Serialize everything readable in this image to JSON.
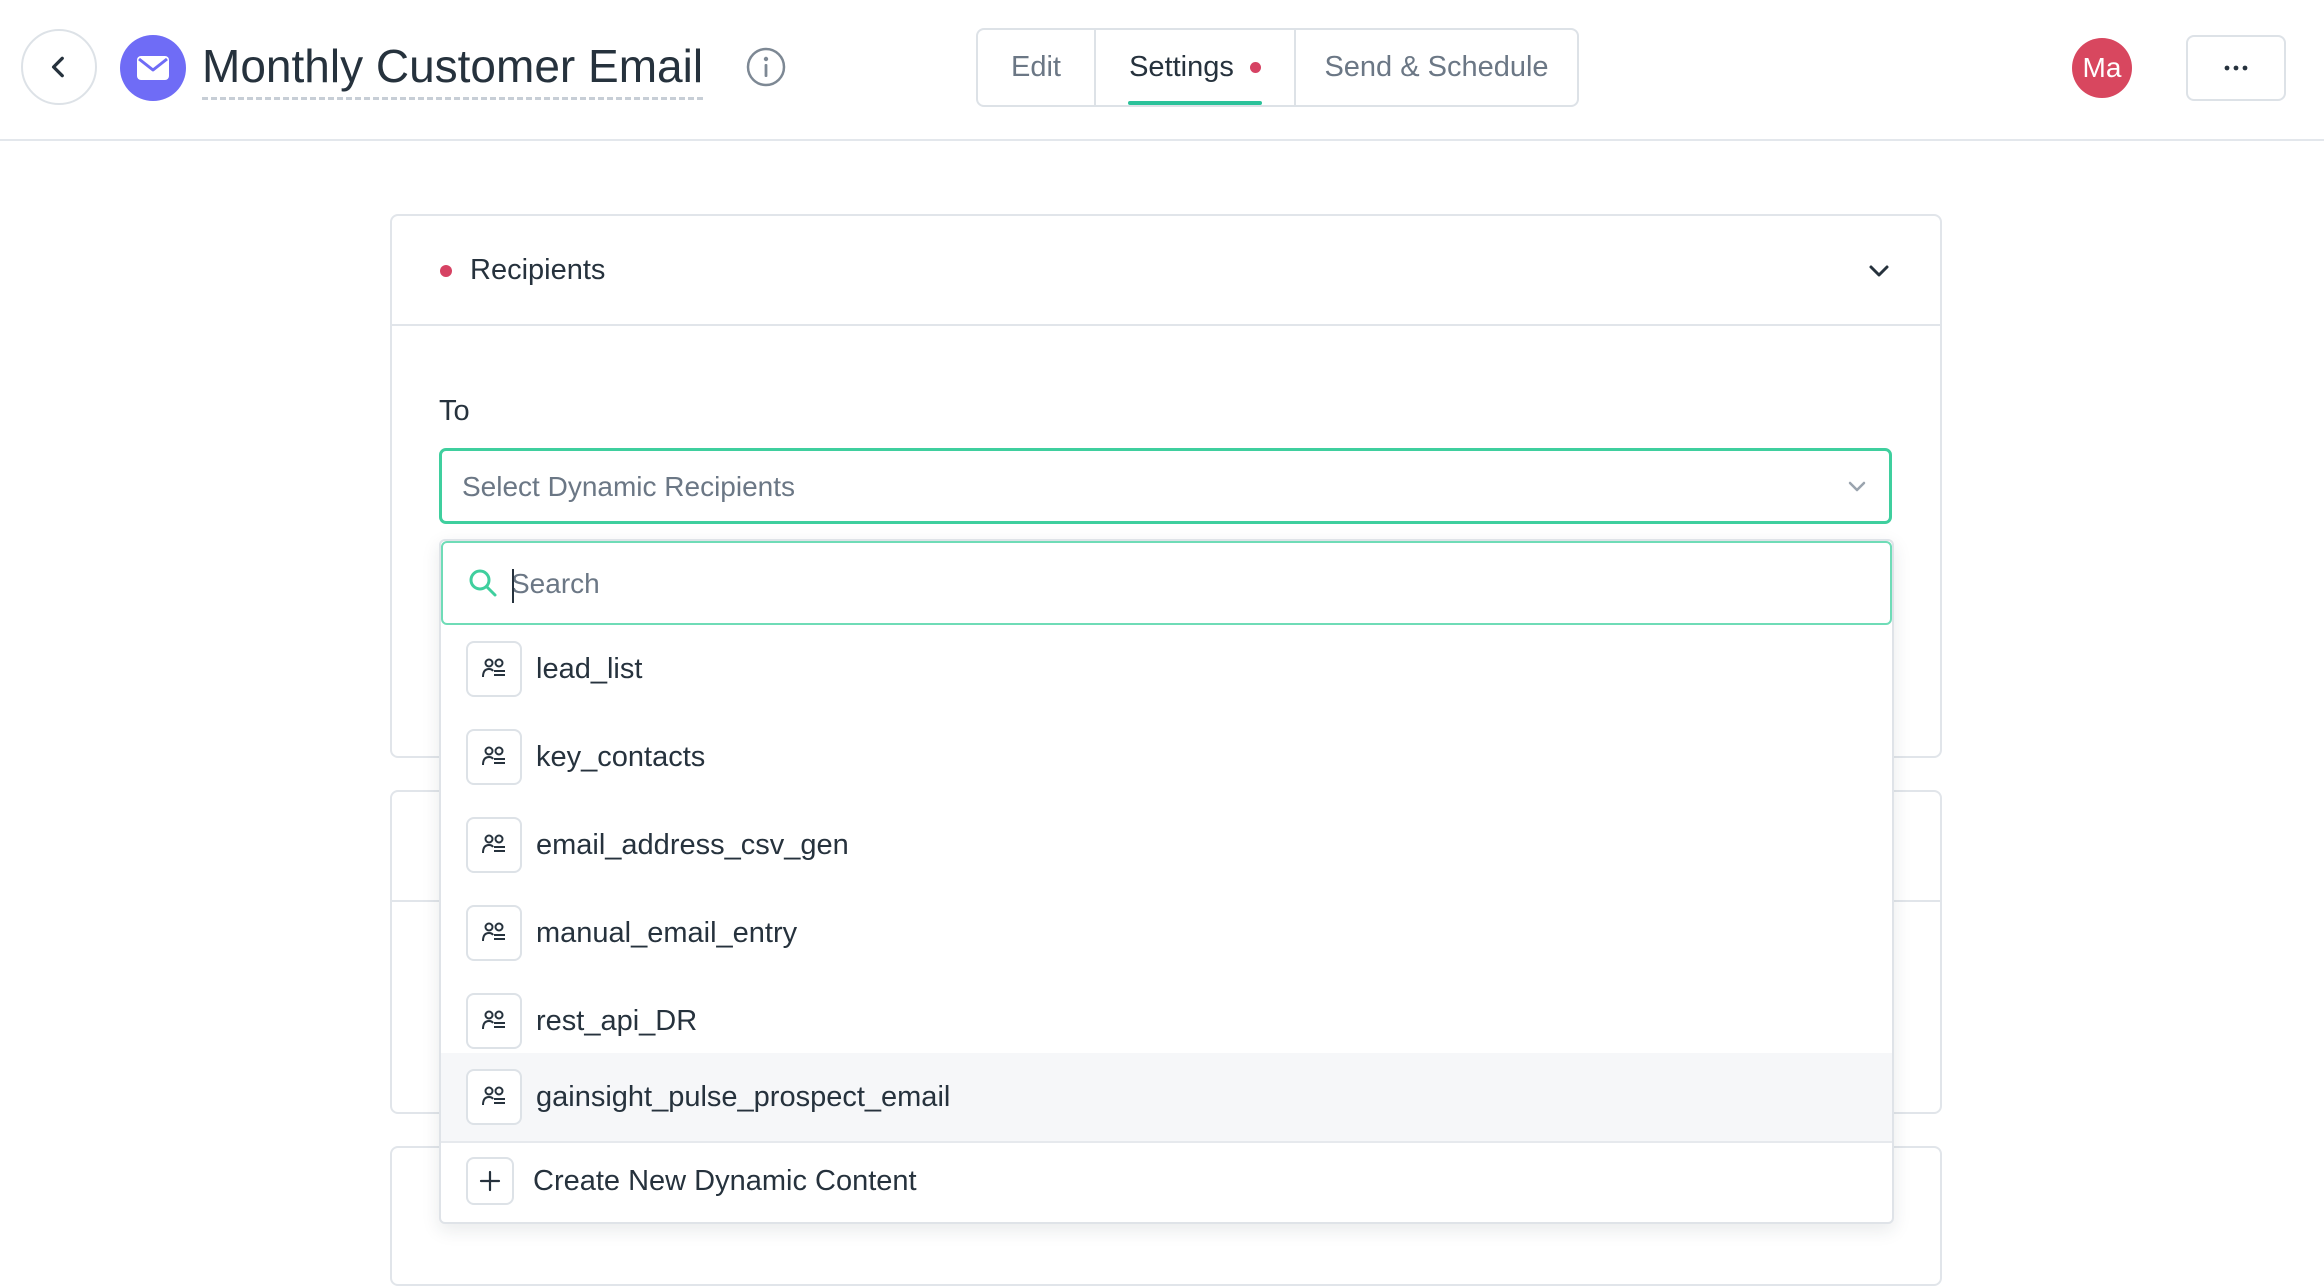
{
  "header": {
    "title": "Monthly Customer Email",
    "tabs": [
      {
        "label": "Edit"
      },
      {
        "label": "Settings",
        "active": true,
        "has_indicator": true
      },
      {
        "label": "Send & Schedule"
      }
    ],
    "avatar_initials": "Ma",
    "more_label": "···",
    "icons": {
      "back": "chevron-left-icon",
      "email": "envelope-icon",
      "info": "info-icon"
    }
  },
  "recipients_section": {
    "title": "Recipients",
    "required_indicator_color": "#d64263",
    "to_label": "To",
    "select_placeholder": "Select Dynamic Recipients",
    "dropdown": {
      "search_placeholder": "Search",
      "options": [
        {
          "label": "lead_list",
          "icon": "dynamic-list-icon"
        },
        {
          "label": "key_contacts",
          "icon": "dynamic-list-icon"
        },
        {
          "label": "email_address_csv_gen",
          "icon": "dynamic-list-icon"
        },
        {
          "label": "manual_email_entry",
          "icon": "dynamic-list-icon"
        },
        {
          "label": "rest_api_DR",
          "icon": "dynamic-list-icon"
        },
        {
          "label": "gainsight_pulse_prospect_email",
          "icon": "dynamic-list-icon",
          "hovered": true
        }
      ],
      "create_label": "Create New Dynamic Content"
    }
  },
  "colors": {
    "accent": "#2bc29a",
    "focus_border": "#3fcf9e",
    "brand_purple": "#6f6cf6",
    "avatar_bg": "#d8475f",
    "required_dot": "#d64263"
  }
}
